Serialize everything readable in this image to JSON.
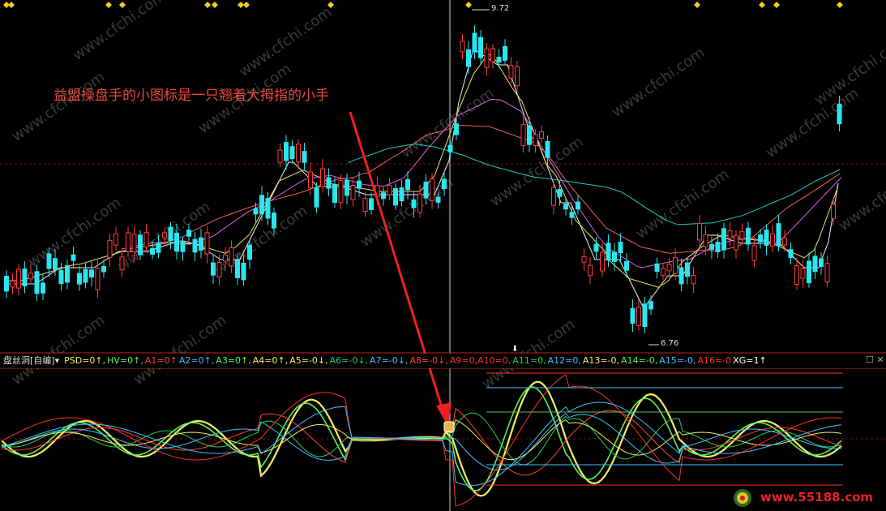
{
  "chart_data": [
    {
      "type": "candlestick",
      "title": "",
      "marks": {
        "high": "9.72",
        "low": "6.76"
      },
      "annotation": "益盟操盘手的小图标是一只翘着大拇指的小手",
      "colors": {
        "up": "#ff3b3b",
        "down": "#29e6f0",
        "ma5": "#f0f0f0",
        "ma10": "#f0e060",
        "ma20": "#e060e0",
        "ma30": "#f06060",
        "ma60": "#20c8c8"
      }
    },
    {
      "type": "line",
      "indicator": {
        "name": "盘丝洞[自编]",
        "dropdown": "▾",
        "items": [
          {
            "text": "PSD=0↑,",
            "color": "#f0f060"
          },
          {
            "text": "HV=0↑,",
            "color": "#60f060"
          },
          {
            "text": "A1=0↑",
            "color": "#ff4040"
          },
          {
            "text": "A2=0↑,",
            "color": "#40c0ff"
          },
          {
            "text": "A3=0↑,",
            "color": "#60f060"
          },
          {
            "text": "A4=0↑,",
            "color": "#f0f060"
          },
          {
            "text": "A5=-0↓,",
            "color": "#f0f060"
          },
          {
            "text": "A6=-0↓,",
            "color": "#20d060"
          },
          {
            "text": "A7=-0↓,",
            "color": "#40c0ff"
          },
          {
            "text": "A8=-0↓,",
            "color": "#ff4040"
          },
          {
            "text": "A9=0,A10=0,",
            "color": "#ff3030"
          },
          {
            "text": "A11=0,",
            "color": "#40c040"
          },
          {
            "text": "A12=0,",
            "color": "#40c0ff"
          },
          {
            "text": "A13=-0,",
            "color": "#f0f060"
          },
          {
            "text": "A14=-0,",
            "color": "#60f060"
          },
          {
            "text": "A15=-0,",
            "color": "#40c0ff"
          },
          {
            "text": "A16=-0",
            "color": "#ff3030"
          },
          {
            "text": "XG=1↑",
            "color": "#ffffff"
          }
        ]
      }
    }
  ],
  "ui": {
    "controls": "☐ ✕",
    "site": "www.55188.com"
  }
}
